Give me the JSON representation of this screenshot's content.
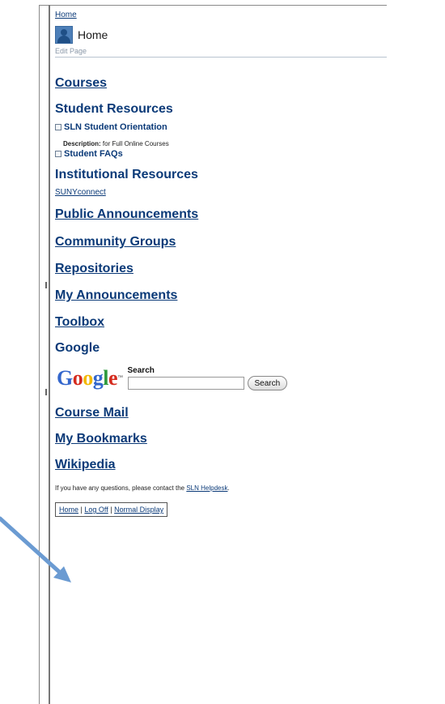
{
  "breadcrumb": {
    "home_link": "Home"
  },
  "page_header": {
    "title": "Home",
    "edit_link": "Edit Page"
  },
  "sections": {
    "courses": "Courses",
    "student_resources": {
      "heading": "Student Resources",
      "items": [
        {
          "label": "SLN Student Orientation",
          "description_label": "Description:",
          "description_text": "for Full Online Courses"
        },
        {
          "label": "Student FAQs"
        }
      ]
    },
    "institutional_resources": {
      "heading": "Institutional Resources",
      "link": "SUNYconnect"
    },
    "public_announcements": "Public Announcements",
    "community_groups": "Community Groups",
    "repositories": "Repositories",
    "my_announcements": "My Announcements",
    "toolbox": "Toolbox",
    "google": {
      "heading": "Google",
      "logo_text": "Google",
      "logo_tm": "™",
      "search_label": "Search",
      "search_value": "",
      "search_button": "Search"
    },
    "course_mail": "Course Mail",
    "my_bookmarks": "My Bookmarks",
    "wikipedia": "Wikipedia"
  },
  "contact": {
    "prefix": "If you have any questions, please contact the ",
    "link": "SLN Helpdesk",
    "suffix": "."
  },
  "footer_nav": {
    "home": "Home",
    "log_off": "Log Off",
    "normal_display": "Normal Display",
    "separator": "|"
  },
  "colors": {
    "link": "#0b3a78",
    "arrow": "#6b9bd2",
    "google_blue": "#3366cc",
    "google_red": "#d52b1e",
    "google_yellow": "#f3b800",
    "google_green": "#2e9a3d"
  }
}
